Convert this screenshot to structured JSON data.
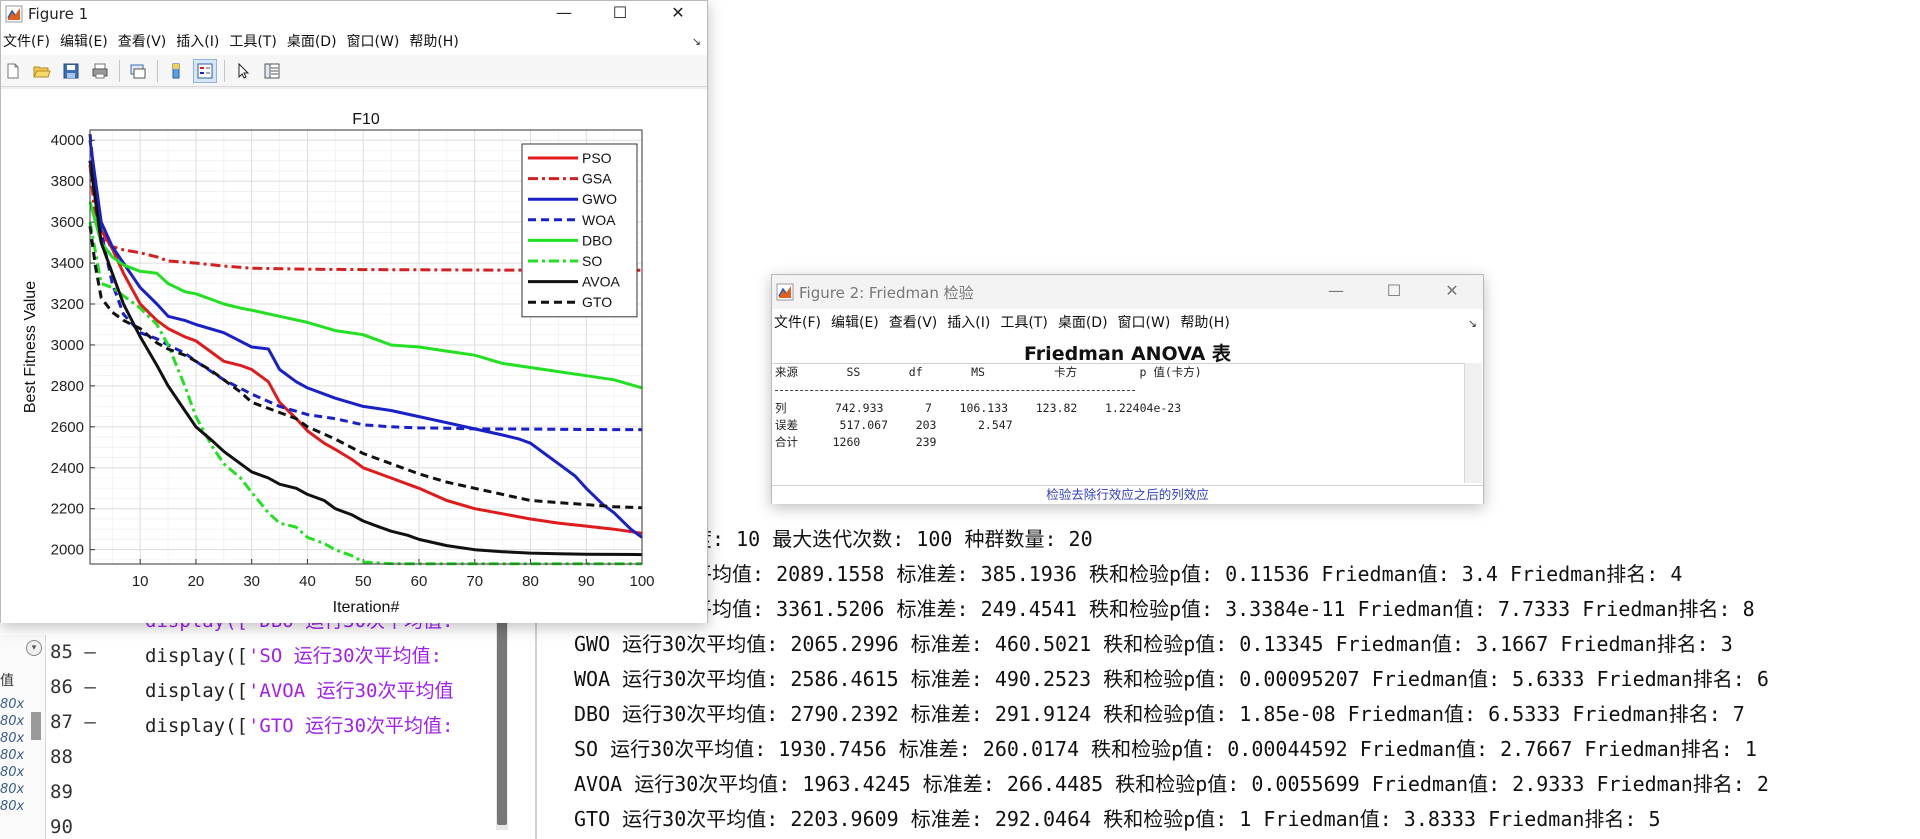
{
  "editor": {
    "workspace_label": "值",
    "workspace_rows": [
      "80x",
      "80x",
      "80x",
      "80x",
      "80x",
      "80x",
      "80x"
    ],
    "line_numbers": [
      "85",
      "86",
      "87",
      "88",
      "89",
      "90"
    ],
    "lines": [
      {
        "prefix": "display([",
        "string": "'SO 运行30次平均值:"
      },
      {
        "prefix": "display([",
        "string": "'AVOA 运行30次平均值"
      },
      {
        "prefix": "display([",
        "string": "'GTO 运行30次平均值:"
      }
    ],
    "partial_line": "display(['DBO 运行30次平均值:"
  },
  "command_output": [
    "维度: 10 最大迭代次数: 100 种群数量: 20",
    "次平均值: 2089.1558 标准差: 385.1936 秩和检验p值: 0.11536 Friedman值: 3.4 Friedman排名: 4",
    "次平均值: 3361.5206 标准差: 249.4541 秩和检验p值: 3.3384e-11 Friedman值: 7.7333 Friedman排名: 8",
    "GWO 运行30次平均值: 2065.2996 标准差: 460.5021 秩和检验p值: 0.13345 Friedman值: 3.1667 Friedman排名: 3",
    "WOA 运行30次平均值: 2586.4615 标准差: 490.2523 秩和检验p值: 0.00095207 Friedman值: 5.6333 Friedman排名: 6",
    "DBO 运行30次平均值: 2790.2392 标准差: 291.9124 秩和检验p值: 1.85e-08 Friedman值: 6.5333 Friedman排名: 7",
    "SO 运行30次平均值: 1930.7456 标准差: 260.0174 秩和检验p值: 0.00044592 Friedman值: 2.7667 Friedman排名: 1",
    "AVOA 运行30次平均值: 1963.4245 标准差: 266.4485 秩和检验p值: 0.0055699 Friedman值: 2.9333 Friedman排名: 2",
    "GTO 运行30次平均值: 2203.9609 标准差: 292.0464 秩和检验p值: 1 Friedman值: 3.8333 Friedman排名: 5"
  ],
  "figure1": {
    "title": "Figure 1",
    "menu": [
      "文件(F)",
      "编辑(E)",
      "查看(V)",
      "插入(I)",
      "工具(T)",
      "桌面(D)",
      "窗口(W)",
      "帮助(H)"
    ],
    "minimize_label": "—",
    "maximize_label": "☐",
    "close_label": "✕"
  },
  "figure2": {
    "title": "Figure 2: Friedman 检验",
    "menu": [
      "文件(F)",
      "编辑(E)",
      "查看(V)",
      "插入(I)",
      "工具(T)",
      "桌面(D)",
      "窗口(W)",
      "帮助(H)"
    ],
    "anova_title": "Friedman ANOVA 表",
    "table_header": "来源       SS       df       MS          卡方         p 值(卡方)",
    "table_rows": [
      "列       742.933      7    106.133    123.82    1.22404e-23",
      "误差      517.067    203      2.547",
      "合计     1260        239"
    ],
    "footer": "检验去除行效应之后的列效应"
  },
  "chart_data": {
    "type": "line",
    "title": "F10",
    "xlabel": "Iteration#",
    "ylabel": "Best Fitness Value",
    "xlim": [
      1,
      100
    ],
    "ylim": [
      1930,
      4050
    ],
    "xticks": [
      10,
      20,
      30,
      40,
      50,
      60,
      70,
      80,
      90,
      100
    ],
    "yticks": [
      2000,
      2200,
      2400,
      2600,
      2800,
      3000,
      3200,
      3400,
      3600,
      3800,
      4000
    ],
    "grid": true,
    "legend_position": "top-right",
    "series": [
      {
        "name": "PSO",
        "color": "#e01b1b",
        "dash": "solid",
        "x": [
          1,
          2,
          3,
          5,
          7,
          10,
          13,
          15,
          18,
          20,
          23,
          25,
          28,
          30,
          33,
          35,
          38,
          40,
          43,
          45,
          48,
          50,
          53,
          55,
          58,
          60,
          65,
          70,
          75,
          80,
          85,
          90,
          95,
          100
        ],
        "y": [
          3900,
          3720,
          3560,
          3470,
          3350,
          3200,
          3120,
          3080,
          3040,
          3020,
          2960,
          2920,
          2900,
          2880,
          2820,
          2720,
          2640,
          2580,
          2520,
          2490,
          2440,
          2400,
          2370,
          2350,
          2320,
          2300,
          2240,
          2200,
          2175,
          2150,
          2130,
          2115,
          2100,
          2080
        ]
      },
      {
        "name": "GSA",
        "color": "#d42020",
        "dash": "dashdot",
        "x": [
          1,
          2,
          3,
          5,
          7,
          10,
          13,
          15,
          20,
          25,
          30,
          40,
          50,
          60,
          70,
          80,
          90,
          100
        ],
        "y": [
          3880,
          3600,
          3520,
          3480,
          3465,
          3450,
          3430,
          3410,
          3400,
          3385,
          3375,
          3370,
          3368,
          3367,
          3366,
          3365,
          3365,
          3365
        ]
      },
      {
        "name": "GWO",
        "color": "#1820c8",
        "dash": "solid",
        "x": [
          1,
          2,
          3,
          5,
          7,
          10,
          13,
          15,
          18,
          20,
          25,
          30,
          33,
          35,
          38,
          40,
          45,
          50,
          55,
          60,
          65,
          70,
          75,
          78,
          80,
          83,
          85,
          88,
          90,
          93,
          95,
          98,
          100
        ],
        "y": [
          4000,
          3800,
          3600,
          3480,
          3400,
          3280,
          3200,
          3140,
          3120,
          3100,
          3060,
          2990,
          2980,
          2880,
          2820,
          2790,
          2740,
          2700,
          2680,
          2650,
          2620,
          2590,
          2560,
          2540,
          2520,
          2460,
          2420,
          2360,
          2300,
          2220,
          2180,
          2100,
          2060
        ]
      },
      {
        "name": "WOA",
        "color": "#1820c8",
        "dash": "dash",
        "x": [
          1,
          2,
          3,
          5,
          7,
          10,
          13,
          15,
          18,
          20,
          25,
          30,
          35,
          40,
          45,
          50,
          55,
          60,
          65,
          70,
          80,
          90,
          100
        ],
        "y": [
          4030,
          3760,
          3550,
          3300,
          3150,
          3060,
          3030,
          3000,
          2960,
          2920,
          2830,
          2760,
          2700,
          2660,
          2640,
          2610,
          2600,
          2595,
          2593,
          2590,
          2589,
          2587,
          2586
        ]
      },
      {
        "name": "DBO",
        "color": "#22e022",
        "dash": "solid",
        "x": [
          1,
          2,
          3,
          5,
          7,
          10,
          13,
          15,
          18,
          20,
          23,
          25,
          28,
          30,
          35,
          40,
          45,
          50,
          55,
          60,
          65,
          70,
          75,
          80,
          85,
          90,
          95,
          100
        ],
        "y": [
          3700,
          3600,
          3500,
          3430,
          3390,
          3360,
          3350,
          3300,
          3260,
          3250,
          3220,
          3200,
          3180,
          3170,
          3140,
          3110,
          3070,
          3050,
          3000,
          2990,
          2970,
          2950,
          2910,
          2890,
          2870,
          2850,
          2830,
          2790
        ]
      },
      {
        "name": "SO",
        "color": "#22e022",
        "dash": "dashdot",
        "x": [
          1,
          2,
          3,
          5,
          7,
          10,
          13,
          15,
          18,
          20,
          23,
          25,
          28,
          30,
          33,
          35,
          38,
          40,
          43,
          45,
          48,
          50,
          53,
          55,
          60,
          70,
          80,
          90,
          100
        ],
        "y": [
          3600,
          3450,
          3300,
          3280,
          3240,
          3180,
          3100,
          3000,
          2800,
          2650,
          2500,
          2420,
          2350,
          2280,
          2180,
          2130,
          2110,
          2060,
          2030,
          2000,
          1970,
          1940,
          1935,
          1932,
          1931,
          1931,
          1931,
          1931,
          1931
        ]
      },
      {
        "name": "AVOA",
        "color": "#111111",
        "dash": "solid",
        "x": [
          1,
          2,
          3,
          5,
          7,
          10,
          13,
          15,
          18,
          20,
          23,
          25,
          28,
          30,
          33,
          35,
          38,
          40,
          43,
          45,
          48,
          50,
          53,
          55,
          58,
          60,
          65,
          70,
          75,
          80,
          85,
          90,
          95,
          100
        ],
        "y": [
          3900,
          3700,
          3500,
          3350,
          3200,
          3040,
          2900,
          2800,
          2680,
          2600,
          2530,
          2480,
          2420,
          2380,
          2350,
          2320,
          2300,
          2270,
          2240,
          2200,
          2170,
          2140,
          2110,
          2090,
          2070,
          2050,
          2020,
          2000,
          1990,
          1983,
          1980,
          1978,
          1977,
          1976
        ]
      },
      {
        "name": "GTO",
        "color": "#111111",
        "dash": "dash",
        "x": [
          1,
          2,
          3,
          5,
          7,
          10,
          13,
          15,
          18,
          20,
          23,
          25,
          28,
          30,
          33,
          35,
          38,
          40,
          45,
          50,
          55,
          60,
          65,
          70,
          75,
          80,
          85,
          90,
          95,
          100
        ],
        "y": [
          3580,
          3380,
          3230,
          3160,
          3120,
          3080,
          3010,
          2980,
          2950,
          2920,
          2870,
          2830,
          2770,
          2720,
          2690,
          2670,
          2640,
          2600,
          2540,
          2470,
          2420,
          2370,
          2330,
          2300,
          2270,
          2240,
          2230,
          2220,
          2210,
          2205
        ]
      }
    ]
  }
}
